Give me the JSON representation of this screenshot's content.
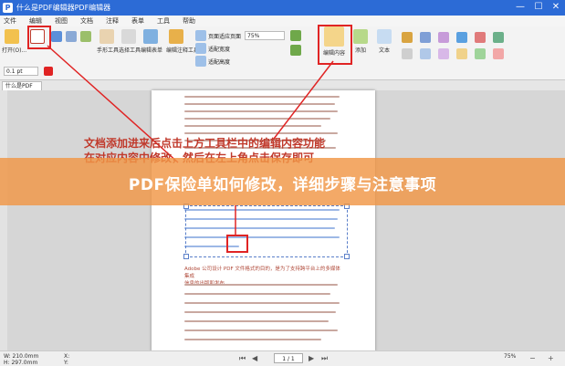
{
  "window": {
    "title": "什么是PDF编辑器PDF编辑器",
    "logo_letter": "P",
    "min": "—",
    "max": "☐",
    "close": "✕"
  },
  "menu": [
    "文件",
    "编辑",
    "视图",
    "文档",
    "注释",
    "表单",
    "工具",
    "帮助"
  ],
  "toolbar": {
    "labels": [
      "打开(O)...",
      "手形工具",
      "选择工具",
      "编辑表单",
      "编辑注释工具",
      "缩放内容",
      "添加",
      "文本"
    ],
    "quick": [
      "页面适应页面",
      "适配宽度",
      "适配高度",
      "适配视区"
    ],
    "zoom": "75%",
    "stroke": "0.1 pt",
    "edit_button": "编辑内容"
  },
  "tab": {
    "label": "什么是PDF"
  },
  "document": {
    "annotation_line1": "文档添加进来后点击上方工具栏中的编辑内容功能",
    "annotation_line2": "在对应内容中修改，然后在左上角点击保存即可",
    "snippet1": "Adobe 公司设计 PDF 文件格式的目的，是为了支持跨平台上的多媒体集成",
    "snippet2": "信息的出版和发布"
  },
  "banner": {
    "text": "PDF保险单如何修改，详细步骤与注意事项"
  },
  "status": {
    "w": "W: 210.0mm",
    "h": "H: 297.0mm",
    "x": "X:",
    "y": "Y:",
    "page": "1 / 1",
    "zoom": "75%"
  },
  "colors": {
    "title_blue": "#2c6bd6",
    "annotation_red": "#e02424",
    "banner": "#f0964a"
  }
}
